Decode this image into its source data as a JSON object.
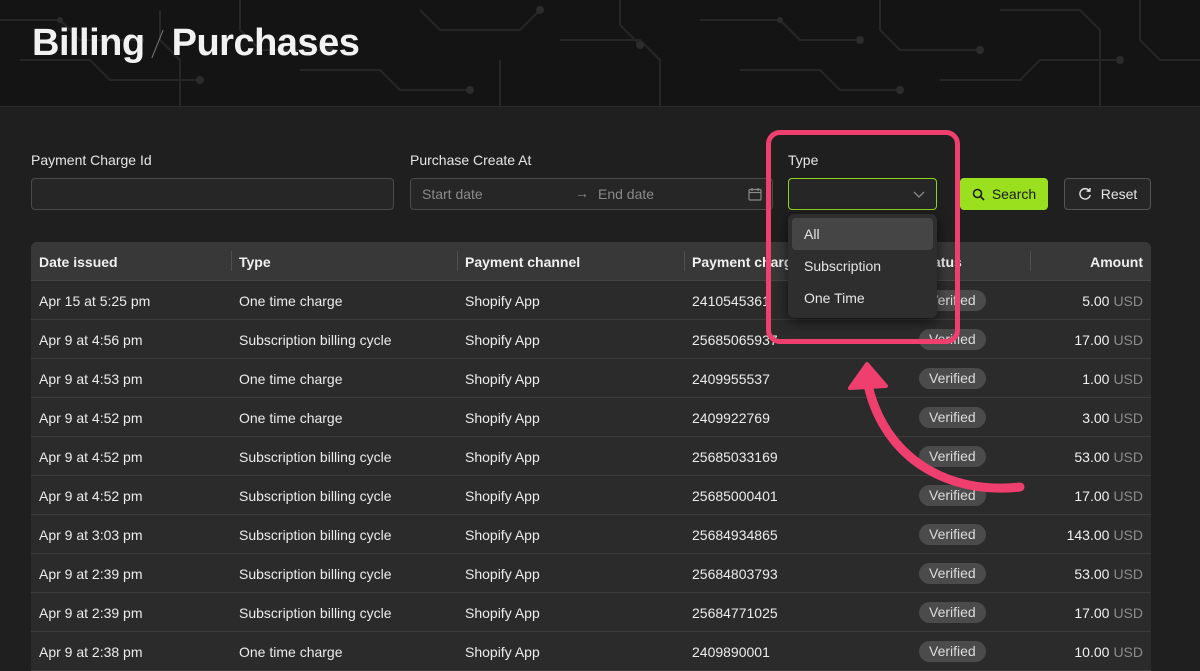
{
  "header": {
    "breadcrumb_parent": "Billing",
    "breadcrumb_current": "Purchases"
  },
  "filters": {
    "payment_charge_id": {
      "label": "Payment Charge Id",
      "value": "",
      "placeholder": ""
    },
    "purchase_create_at": {
      "label": "Purchase Create At",
      "start_placeholder": "Start date",
      "end_placeholder": "End date",
      "separator": "→"
    },
    "type": {
      "label": "Type",
      "value": "",
      "options": [
        "All",
        "Subscription",
        "One Time"
      ],
      "highlighted_option": "All"
    },
    "search_label": "Search",
    "reset_label": "Reset"
  },
  "table": {
    "columns": [
      "Date issued",
      "Type",
      "Payment channel",
      "Payment charge",
      "Status",
      "Amount"
    ],
    "rows": [
      {
        "date": "Apr 15 at 5:25 pm",
        "type": "One time charge",
        "channel": "Shopify App",
        "charge": "2410545361",
        "status": "Verified",
        "amount": "5.00",
        "currency": "USD"
      },
      {
        "date": "Apr 9 at 4:56 pm",
        "type": "Subscription billing cycle",
        "channel": "Shopify App",
        "charge": "25685065937",
        "status": "Verified",
        "amount": "17.00",
        "currency": "USD"
      },
      {
        "date": "Apr 9 at 4:53 pm",
        "type": "One time charge",
        "channel": "Shopify App",
        "charge": "2409955537",
        "status": "Verified",
        "amount": "1.00",
        "currency": "USD"
      },
      {
        "date": "Apr 9 at 4:52 pm",
        "type": "One time charge",
        "channel": "Shopify App",
        "charge": "2409922769",
        "status": "Verified",
        "amount": "3.00",
        "currency": "USD"
      },
      {
        "date": "Apr 9 at 4:52 pm",
        "type": "Subscription billing cycle",
        "channel": "Shopify App",
        "charge": "25685033169",
        "status": "Verified",
        "amount": "53.00",
        "currency": "USD"
      },
      {
        "date": "Apr 9 at 4:52 pm",
        "type": "Subscription billing cycle",
        "channel": "Shopify App",
        "charge": "25685000401",
        "status": "Verified",
        "amount": "17.00",
        "currency": "USD"
      },
      {
        "date": "Apr 9 at 3:03 pm",
        "type": "Subscription billing cycle",
        "channel": "Shopify App",
        "charge": "25684934865",
        "status": "Verified",
        "amount": "143.00",
        "currency": "USD"
      },
      {
        "date": "Apr 9 at 2:39 pm",
        "type": "Subscription billing cycle",
        "channel": "Shopify App",
        "charge": "25684803793",
        "status": "Verified",
        "amount": "53.00",
        "currency": "USD"
      },
      {
        "date": "Apr 9 at 2:39 pm",
        "type": "Subscription billing cycle",
        "channel": "Shopify App",
        "charge": "25684771025",
        "status": "Verified",
        "amount": "17.00",
        "currency": "USD"
      },
      {
        "date": "Apr 9 at 2:38 pm",
        "type": "One time charge",
        "channel": "Shopify App",
        "charge": "2409890001",
        "status": "Verified",
        "amount": "10.00",
        "currency": "USD"
      }
    ]
  },
  "colors": {
    "accent": "#9be01f",
    "annotation": "#ef3f6e",
    "background": "#1f1f1f"
  }
}
